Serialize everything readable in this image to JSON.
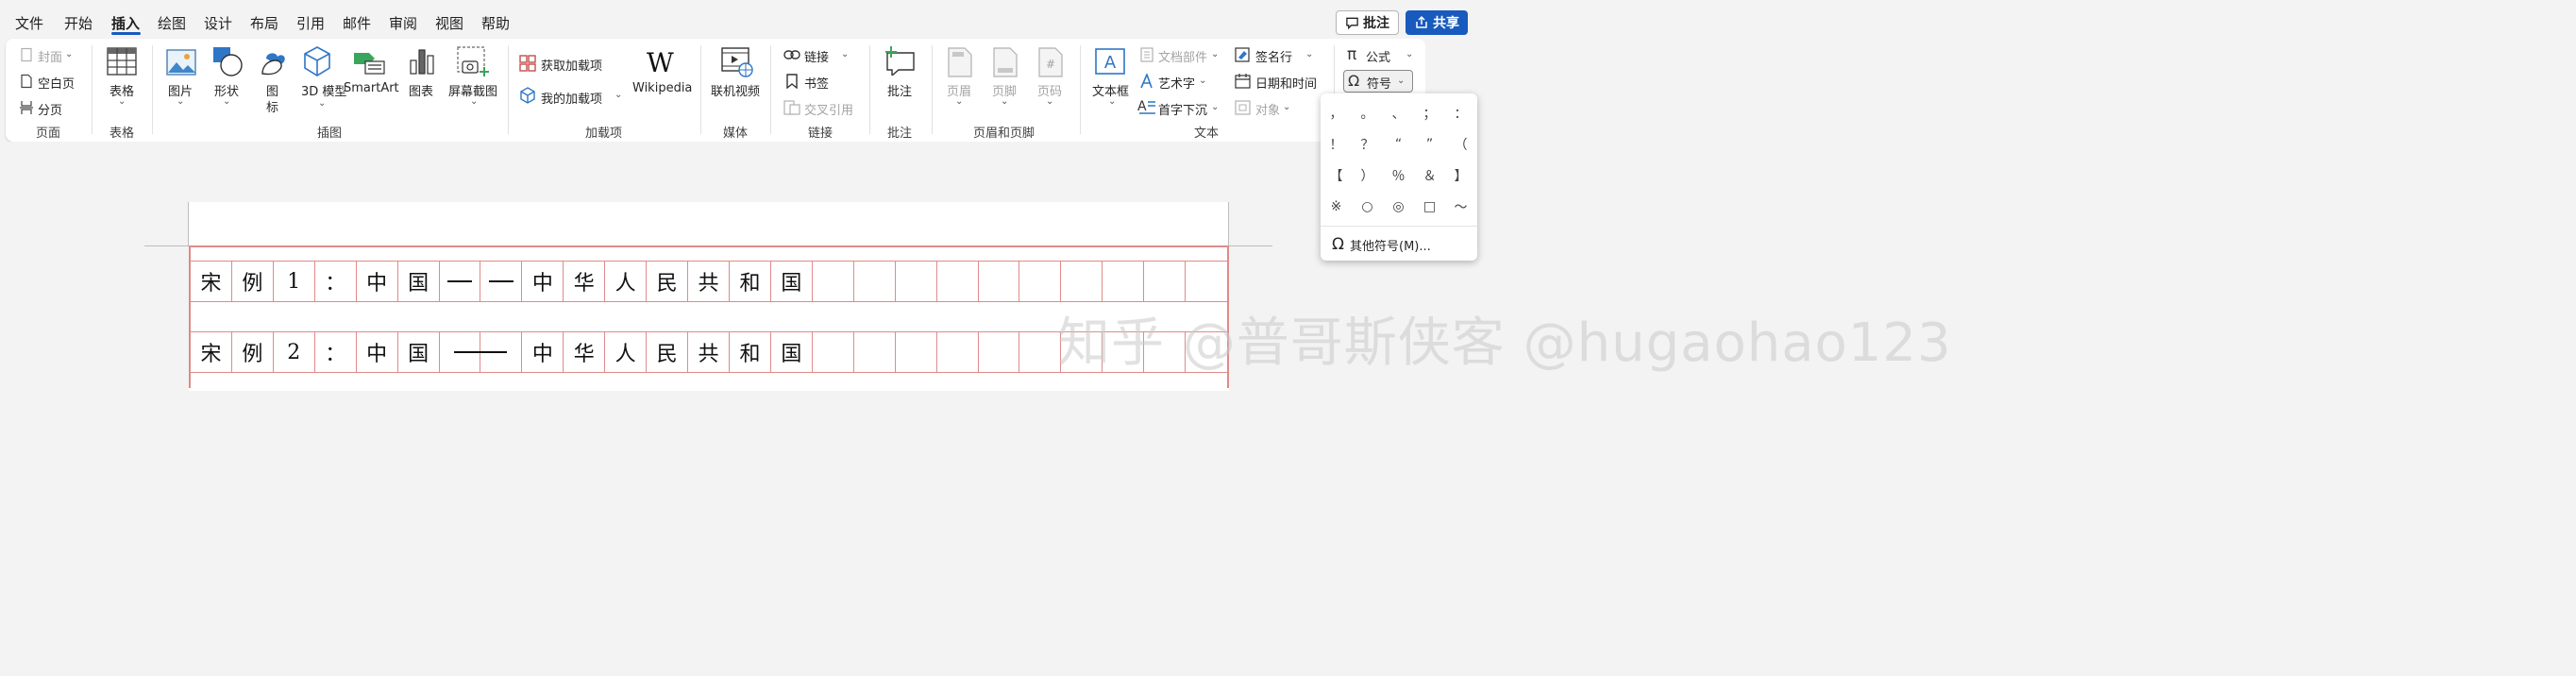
{
  "menu": {
    "tabs": [
      "文件",
      "开始",
      "插入",
      "绘图",
      "设计",
      "布局",
      "引用",
      "邮件",
      "审阅",
      "视图",
      "帮助"
    ],
    "active": "插入",
    "review_button": "批注",
    "share_button": "共享"
  },
  "ribbon": {
    "pages": {
      "cover": "封面",
      "blank": "空白页",
      "break": "分页",
      "group": "页面"
    },
    "tables": {
      "table": "表格",
      "group": "表格"
    },
    "illustrations": {
      "pictures": "图片",
      "shapes": "形状",
      "icons": "图标",
      "model3d": "3D 模型",
      "smartart": "SmartArt",
      "chart": "图表",
      "screenshot": "屏幕截图",
      "group": "插图"
    },
    "addins": {
      "get": "获取加载项",
      "mine": "我的加载项",
      "wikipedia": "Wikipedia",
      "group": "加载项"
    },
    "media": {
      "video": "联机视频",
      "group": "媒体"
    },
    "links": {
      "link": "链接",
      "bookmark": "书签",
      "crossref": "交叉引用",
      "group": "链接"
    },
    "comments": {
      "comment": "批注",
      "group": "批注"
    },
    "headerfooter": {
      "header": "页眉",
      "footer": "页脚",
      "pagenum": "页码",
      "group": "页眉和页脚"
    },
    "text": {
      "textbox": "文本框",
      "quickparts": "文档部件",
      "wordart": "艺术字",
      "dropcap": "首字下沉",
      "signature": "签名行",
      "datetime": "日期和时间",
      "object": "对象",
      "group": "文本"
    },
    "symbols": {
      "equation": "公式",
      "symbol": "符号"
    }
  },
  "symbol_panel": {
    "symbols": [
      "，",
      "。",
      "、",
      "；",
      "：",
      "！",
      "？",
      "“",
      "”",
      "（",
      "【",
      "）",
      "％",
      "＆",
      "】",
      "※",
      "○",
      "◎",
      "□",
      "～"
    ],
    "more": "其他符号(M)..."
  },
  "document": {
    "row1": [
      "宋",
      "例",
      "1",
      "：",
      "中",
      "国",
      "—",
      "—",
      "中",
      "华",
      "人",
      "民",
      "共",
      "和",
      "国",
      "",
      "",
      "",
      "",
      "",
      "",
      "",
      "",
      "",
      ""
    ],
    "row2": [
      "宋",
      "例",
      "2",
      "：",
      "中",
      "国",
      "——",
      "",
      "中",
      "华",
      "人",
      "民",
      "共",
      "和",
      "国",
      "",
      "",
      "",
      "",
      "",
      "",
      "",
      "",
      "",
      ""
    ],
    "watermark": "知乎 @普哥斯侠客 @hugaohao123"
  }
}
